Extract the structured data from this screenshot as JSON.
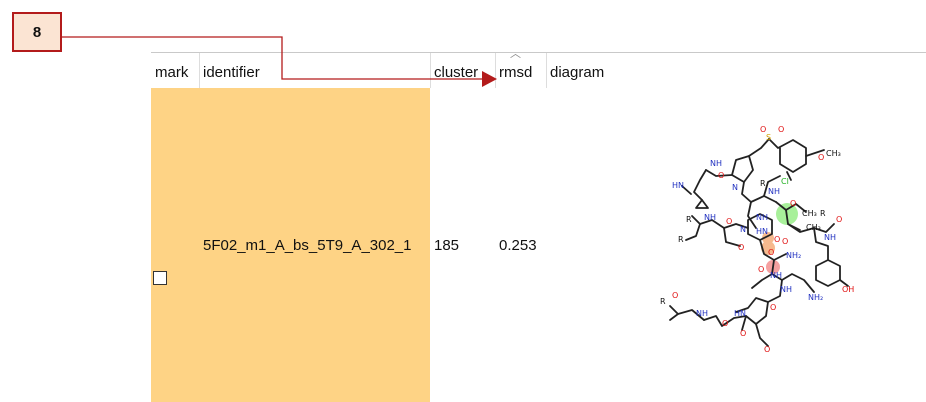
{
  "step": {
    "number": "8"
  },
  "table": {
    "columns": [
      {
        "key": "mark",
        "label": "mark"
      },
      {
        "key": "identifier",
        "label": "identifier"
      },
      {
        "key": "cluster",
        "label": "cluster"
      },
      {
        "key": "rmsd",
        "label": "rmsd",
        "sorted": "ascending"
      },
      {
        "key": "diagram",
        "label": "diagram"
      }
    ],
    "rows": [
      {
        "mark": false,
        "identifier": "5F02_m1_A_bs_5T9_A_302_1",
        "cluster": "185",
        "rmsd": "0.253",
        "highlight_color": "#fed385"
      }
    ]
  },
  "diagram": {
    "labels": [
      "HN",
      "NH",
      "N",
      "O",
      "S",
      "O",
      "Cl",
      "O",
      "CH3",
      "R",
      "NH",
      "O",
      "NH",
      "CH3",
      "CH3",
      "R",
      "O",
      "NH",
      "O",
      "R",
      "NH",
      "O",
      "R",
      "N",
      "O",
      "HN",
      "O",
      "O",
      "NH2",
      "O",
      "NH",
      "O",
      "OH",
      "R",
      "NH",
      "O",
      "HN",
      "NH",
      "NH2",
      "O",
      "O"
    ]
  },
  "colors": {
    "accent_red": "#b31b1b",
    "badge_fill": "#fbe4d3",
    "row_highlight": "#fed385"
  }
}
